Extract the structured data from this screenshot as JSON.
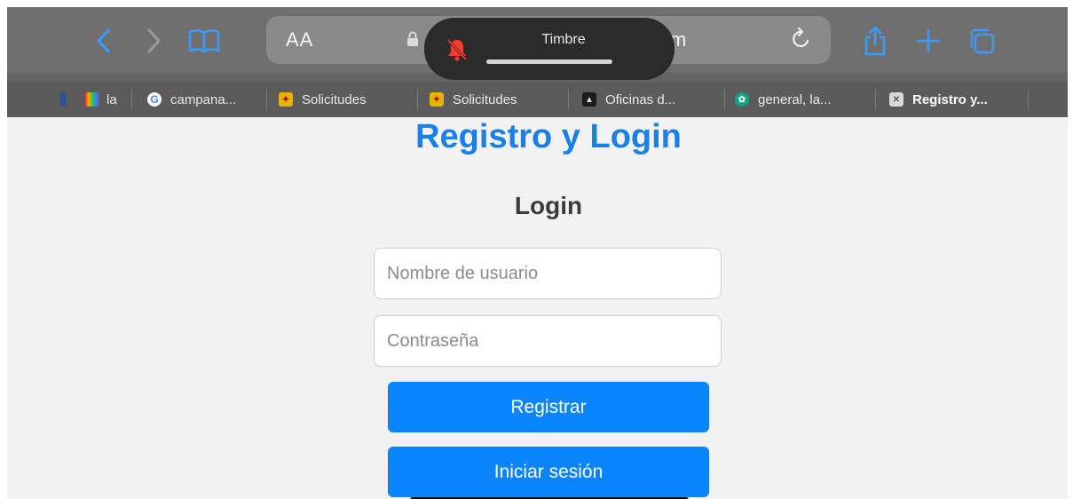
{
  "browser": {
    "address_aa": "AA",
    "url_fragment": "m",
    "notification_title": "Timbre",
    "accent": "#0a84ff"
  },
  "tabs": [
    {
      "label": "la",
      "icon": "rainbow-favicon"
    },
    {
      "label": "campana...",
      "icon": "google-favicon"
    },
    {
      "label": "Solicitudes",
      "icon": "spain-seal-favicon"
    },
    {
      "label": "Solicitudes",
      "icon": "spain-seal-favicon"
    },
    {
      "label": "Oficinas d...",
      "icon": "building-favicon"
    },
    {
      "label": "general, la...",
      "icon": "chat-favicon"
    },
    {
      "label": "Registro y...",
      "icon": "close-box-favicon"
    }
  ],
  "page": {
    "title": "Registro y Login",
    "subtitle": "Login",
    "username_placeholder": "Nombre de usuario",
    "password_placeholder": "Contraseña",
    "register_button": "Registrar",
    "login_button": "Iniciar sesión"
  }
}
